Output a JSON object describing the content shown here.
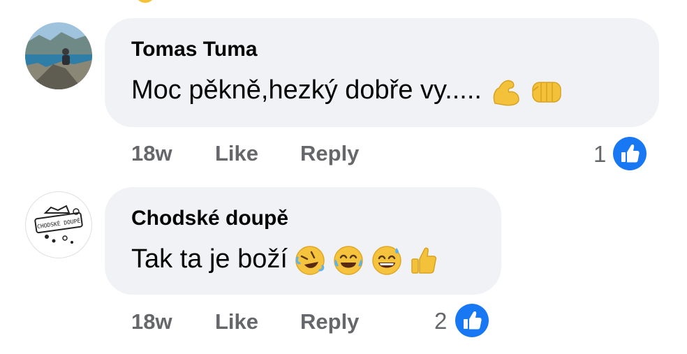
{
  "comments": [
    {
      "author": "Tomas Tuma",
      "text": "Moc pěkně,hezký dobře vy.....",
      "emojis": [
        "flexed-biceps",
        "oncoming-fist"
      ],
      "time": "18w",
      "like_label": "Like",
      "reply_label": "Reply",
      "reaction_count": "1",
      "avatar_icon": "mountain-photo-avatar"
    },
    {
      "author": "Chodské doupě",
      "text": "Tak ta je boží",
      "emojis": [
        "rolling-on-floor-laughing",
        "face-with-tears-of-joy",
        "grinning-face-with-sweat",
        "thumbs-up"
      ],
      "time": "18w",
      "like_label": "Like",
      "reply_label": "Reply",
      "reaction_count": "2",
      "avatar_icon": "chodske-doupe-logo",
      "avatar_logo_text": "CHODSKÉ DOUPĚ"
    }
  ],
  "colors": {
    "bubble": "#f0f2f5",
    "meta_text": "#65676b",
    "like_blue": "#1877f2"
  }
}
